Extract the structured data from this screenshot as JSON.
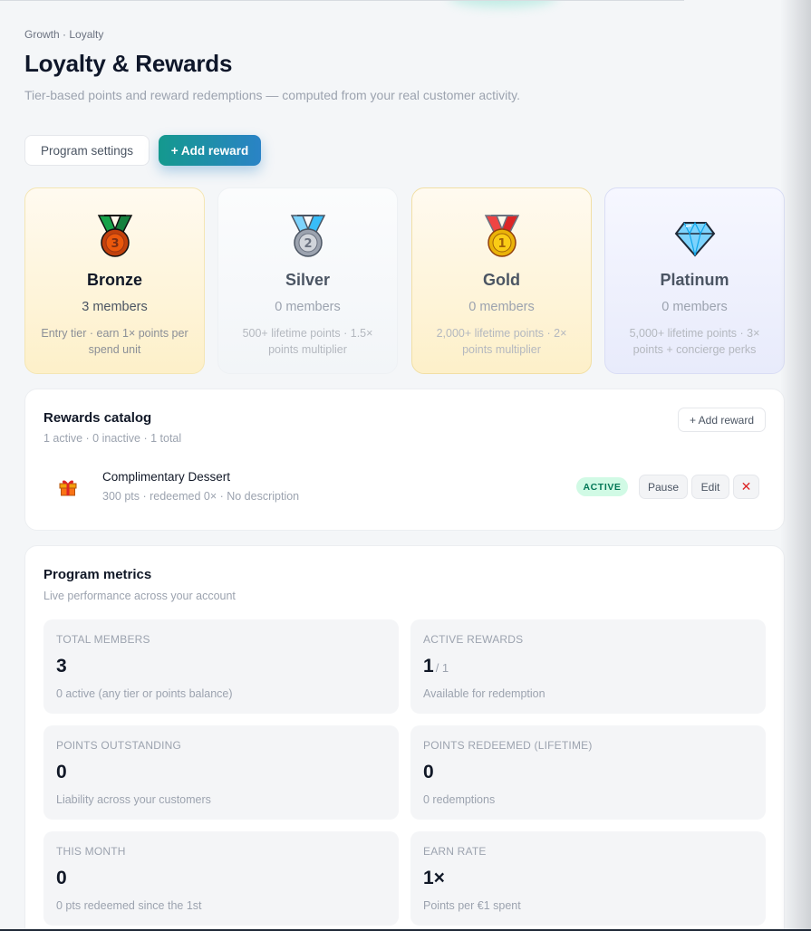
{
  "breadcrumb": "Growth · Loyalty",
  "page": {
    "title": "Loyalty & Rewards",
    "subtitle": "Tier-based points and reward redemptions — computed from your real customer activity."
  },
  "toolbar": {
    "settings_label": "Program settings",
    "add_reward_label": "+ Add reward"
  },
  "tiers": [
    {
      "name": "Bronze",
      "members": "3 members",
      "desc": "Entry tier · earn 1× points per spend unit",
      "medal_number": "3",
      "icon": "bronze-medal-icon"
    },
    {
      "name": "Silver",
      "members": "0 members",
      "desc": "500+ lifetime points · 1.5× points multiplier",
      "medal_number": "2",
      "icon": "silver-medal-icon"
    },
    {
      "name": "Gold",
      "members": "0 members",
      "desc": "2,000+ lifetime points · 2× points multiplier",
      "medal_number": "1",
      "icon": "gold-medal-icon"
    },
    {
      "name": "Platinum",
      "members": "0 members",
      "desc": "5,000+ lifetime points · 3× points + concierge perks",
      "icon": "diamond-icon"
    }
  ],
  "catalog": {
    "title": "Rewards catalog",
    "summary": "1 active · 0 inactive · 1 total",
    "add_label": "+ Add reward",
    "items": [
      {
        "name": "Complimentary Dessert",
        "meta": "300 pts · redeemed 0× · No description",
        "status": "ACTIVE",
        "pause_label": "Pause",
        "edit_label": "Edit",
        "remove_label": "✕",
        "icon": "gift-icon"
      }
    ]
  },
  "metrics": {
    "title": "Program metrics",
    "subtitle": "Live performance across your account",
    "items": [
      {
        "label": "Total members",
        "value": "3",
        "suffix": "",
        "note": "0 active (any tier or points balance)"
      },
      {
        "label": "Active rewards",
        "value": "1",
        "suffix": "/ 1",
        "note": "Available for redemption"
      },
      {
        "label": "Points outstanding",
        "value": "0",
        "suffix": "",
        "note": "Liability across your customers"
      },
      {
        "label": "Points redeemed (lifetime)",
        "value": "0",
        "suffix": "",
        "note": "0 redemptions"
      },
      {
        "label": "This month",
        "value": "0",
        "suffix": "",
        "note": "0 pts redeemed since the 1st"
      },
      {
        "label": "Earn rate",
        "value": "1×",
        "suffix": "",
        "note": "Points per €1 spent"
      }
    ]
  },
  "colors": {
    "accent_gradient_start": "#14998e",
    "accent_gradient_end": "#2a83c6",
    "active_badge_bg": "#d1fae5",
    "active_badge_text": "#047857",
    "remove_red": "#dc2626"
  }
}
